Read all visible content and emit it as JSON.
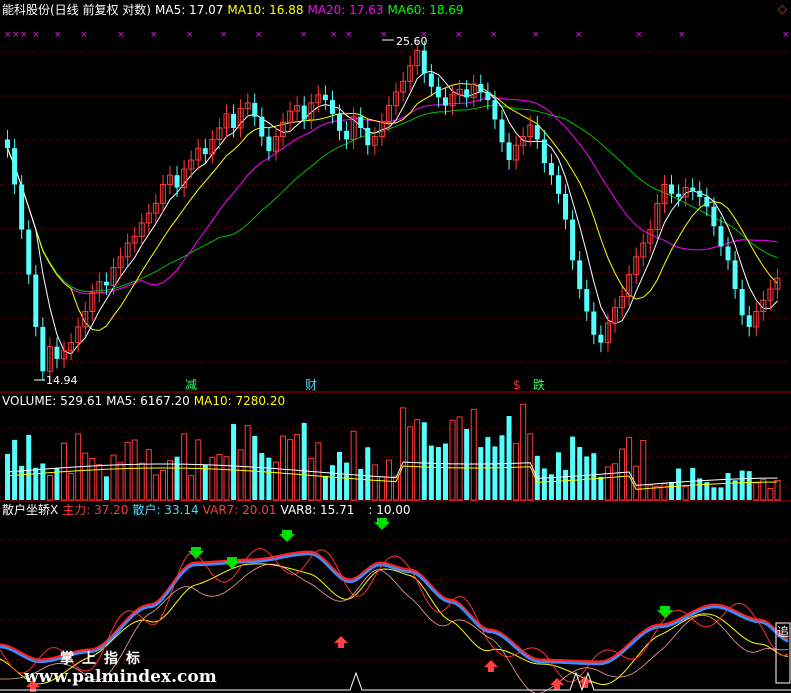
{
  "main_header": {
    "stock": "能科股份(日线 前复权 对数)",
    "ma5": "MA5: 17.07",
    "ma10": "MA10: 16.88",
    "ma20": "MA20: 17.63",
    "ma60": "MA60: 18.69"
  },
  "volume_header": {
    "volume": "VOLUME: 529.61",
    "ma5": "MA5: 6167.20",
    "ma10": "MA10: 7280.20"
  },
  "indicator_header": {
    "name": "散户坐轿X",
    "zhuli": "主力: 37.20",
    "sanhu": "散户: 33.14",
    "var7": "VAR7: 20.01",
    "var8": "VAR8: 15.71",
    "extra": ": 10.00"
  },
  "price_labels": {
    "high": "25.60",
    "low": "14.94"
  },
  "event_labels": [
    {
      "text": "减",
      "color": "#33ff66",
      "x": 185
    },
    {
      "text": "财",
      "color": "#4fd8ff",
      "x": 305
    },
    {
      "text": "$",
      "color": "#ff3030",
      "x": 513
    },
    {
      "text": "跌",
      "color": "#33ff66",
      "x": 533
    }
  ],
  "corner_label": "追",
  "watermark": {
    "line1": "掌上指标",
    "line2": "www.palmindex.com"
  },
  "colors": {
    "up": "#ff3b3b",
    "down": "#54ffff",
    "ma5": "#ffffff",
    "ma10": "#ffff00",
    "ma20": "#ff00ff",
    "ma60": "#00c000",
    "zhuli": "#ff2020",
    "sanhu": "#3a8cff",
    "grid": "#8b0000"
  },
  "chart_data": {
    "type": "candlestick",
    "title": "能科股份(日线 前复权 对数)",
    "y_range": [
      14.94,
      25.6
    ],
    "note": "Values estimated from the candle pattern; prices on log scale",
    "close": [
      21.5,
      20.3,
      18.9,
      17.6,
      16.2,
      15.1,
      15.7,
      15.4,
      15.6,
      15.8,
      16.2,
      16.6,
      17.1,
      17.4,
      17.3,
      17.8,
      18.1,
      18.5,
      18.7,
      19.1,
      19.4,
      19.7,
      20.3,
      20.6,
      20.2,
      20.8,
      21.1,
      21.5,
      21.3,
      21.8,
      22.2,
      22.7,
      22.2,
      22.9,
      23.1,
      22.6,
      21.9,
      21.4,
      21.9,
      22.4,
      22.8,
      23.0,
      22.5,
      23.1,
      23.4,
      23.2,
      22.7,
      22.1,
      21.8,
      22.6,
      22.2,
      21.6,
      21.9,
      22.4,
      23.0,
      23.5,
      23.9,
      24.5,
      25.1,
      24.2,
      23.7,
      23.3,
      23.0,
      23.4,
      23.6,
      23.3,
      23.8,
      23.5,
      23.2,
      22.5,
      21.7,
      21.1,
      21.6,
      21.9,
      22.3,
      21.8,
      21.0,
      20.6,
      20.0,
      19.2,
      18.0,
      17.2,
      16.6,
      16.0,
      15.8,
      16.3,
      16.7,
      17.0,
      17.6,
      18.1,
      18.5,
      18.9,
      19.7,
      20.3,
      20.0,
      19.9,
      20.2,
      20.1,
      19.9,
      19.6,
      19.0,
      18.4,
      18.0,
      17.2,
      16.5,
      16.2,
      16.6,
      16.9,
      17.2,
      17.5
    ],
    "open": [
      21.8,
      21.5,
      20.3,
      18.9,
      17.6,
      16.2,
      15.1,
      15.7,
      15.4,
      15.6,
      15.8,
      16.2,
      16.6,
      17.1,
      17.4,
      17.3,
      17.8,
      18.1,
      18.5,
      18.7,
      19.1,
      19.4,
      19.7,
      20.3,
      20.6,
      20.2,
      20.8,
      21.1,
      21.5,
      21.3,
      21.8,
      22.2,
      22.7,
      22.2,
      22.9,
      23.1,
      22.6,
      21.9,
      21.4,
      21.9,
      22.4,
      22.8,
      23.0,
      22.5,
      23.1,
      23.4,
      23.2,
      22.7,
      22.1,
      21.8,
      22.6,
      22.2,
      21.6,
      21.9,
      22.4,
      23.0,
      23.5,
      23.9,
      24.5,
      25.1,
      24.2,
      23.7,
      23.3,
      23.0,
      23.4,
      23.6,
      23.3,
      23.8,
      23.5,
      23.2,
      22.5,
      21.7,
      21.1,
      21.6,
      21.9,
      22.3,
      21.8,
      21.0,
      20.6,
      20.0,
      19.2,
      18.0,
      17.2,
      16.6,
      16.0,
      15.8,
      16.3,
      16.7,
      17.0,
      17.6,
      18.1,
      18.5,
      18.9,
      19.7,
      20.3,
      20.0,
      19.9,
      20.2,
      20.1,
      19.9,
      19.6,
      19.0,
      18.4,
      18.0,
      17.2,
      16.5,
      16.2,
      16.6,
      16.9,
      17.2
    ],
    "volume_max": 10000
  }
}
